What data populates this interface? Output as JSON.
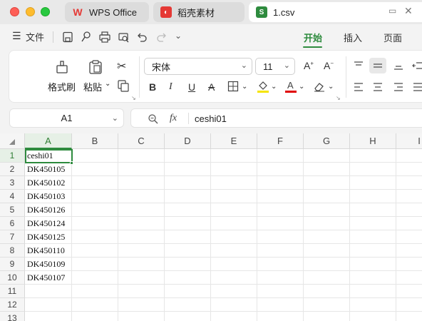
{
  "tabs": [
    {
      "label": "WPS Office",
      "icon": "wps-logo-icon",
      "color": "#e53935"
    },
    {
      "label": "稻壳素材",
      "icon": "docer-logo-icon",
      "color": "#e53935"
    },
    {
      "label": "1.csv",
      "icon": "spreadsheet-s-icon",
      "color": "#2e8b3e"
    }
  ],
  "menu": {
    "file_label": "文件",
    "ribbon_tabs": [
      "开始",
      "插入",
      "页面"
    ],
    "active_tab": "开始"
  },
  "ribbon": {
    "format_painter": "格式刷",
    "paste": "粘贴",
    "font_name": "宋体",
    "font_size": "11",
    "bold": "B",
    "italic": "I",
    "underline": "U",
    "strike": "A"
  },
  "formula_bar": {
    "name_box": "A1",
    "fx_label": "fx",
    "formula": "ceshi01"
  },
  "sheet": {
    "columns": [
      "A",
      "B",
      "C",
      "D",
      "E",
      "F",
      "G",
      "H",
      "I"
    ],
    "rows": [
      "1",
      "2",
      "3",
      "4",
      "5",
      "6",
      "7",
      "8",
      "9",
      "10",
      "11",
      "12",
      "13"
    ],
    "column_a_values": [
      "ceshi01",
      "DK450105",
      "DK450102",
      "DK450103",
      "DK450126",
      "DK450124",
      "DK450125",
      "DK450110",
      "DK450109",
      "DK450107",
      "",
      "",
      ""
    ],
    "selected_cell": "A1"
  },
  "colors": {
    "accent": "#2e8b3e"
  }
}
